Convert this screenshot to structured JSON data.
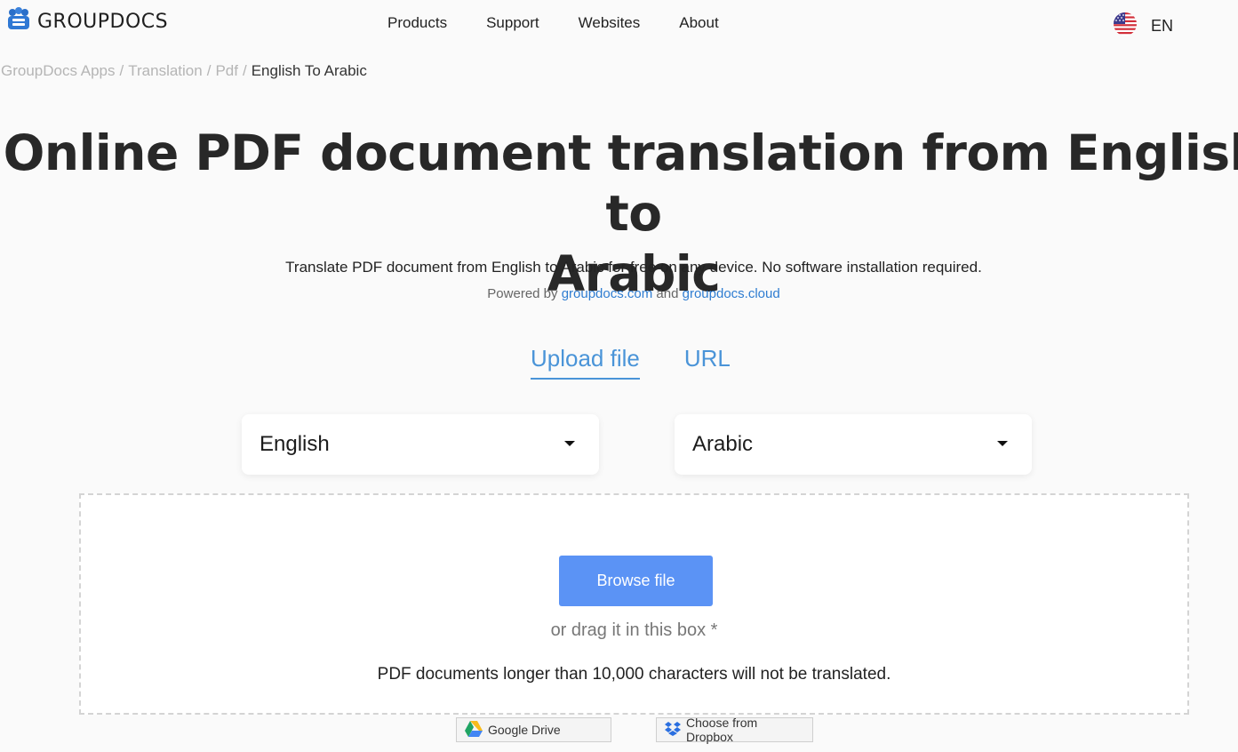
{
  "header": {
    "logo_text": "GROUPDOCS",
    "nav": [
      {
        "label": "Products"
      },
      {
        "label": "Support"
      },
      {
        "label": "Websites"
      },
      {
        "label": "About"
      }
    ],
    "language": "EN"
  },
  "breadcrumb": {
    "items": [
      "GroupDocs Apps",
      "Translation",
      "Pdf"
    ],
    "separator": "/",
    "current": "English To Arabic"
  },
  "hero": {
    "title_line1": "Online PDF document translation from English to",
    "title_line2": "Arabic",
    "subtitle": "Translate PDF document from English to Arabic for free on any device. No software installation required.",
    "powered_prefix": "Powered by",
    "powered_link1": "groupdocs.com",
    "powered_and": "and",
    "powered_link2": "groupdocs.cloud"
  },
  "tabs": [
    {
      "label": "Upload file",
      "active": true
    },
    {
      "label": "URL",
      "active": false
    }
  ],
  "source_language": {
    "selected": "English"
  },
  "target_language": {
    "selected": "Arabic"
  },
  "dropzone": {
    "browse_label": "Browse file",
    "drag_text": "or drag it in this box *",
    "limit_text": "PDF documents longer than 10,000 characters will not be translated."
  },
  "cloud": {
    "google_drive_label": "Google Drive",
    "dropbox_label": "Choose from Dropbox"
  },
  "colors": {
    "accent": "#4a94d8",
    "button": "#5b93f5",
    "link": "#2f7dd1"
  }
}
